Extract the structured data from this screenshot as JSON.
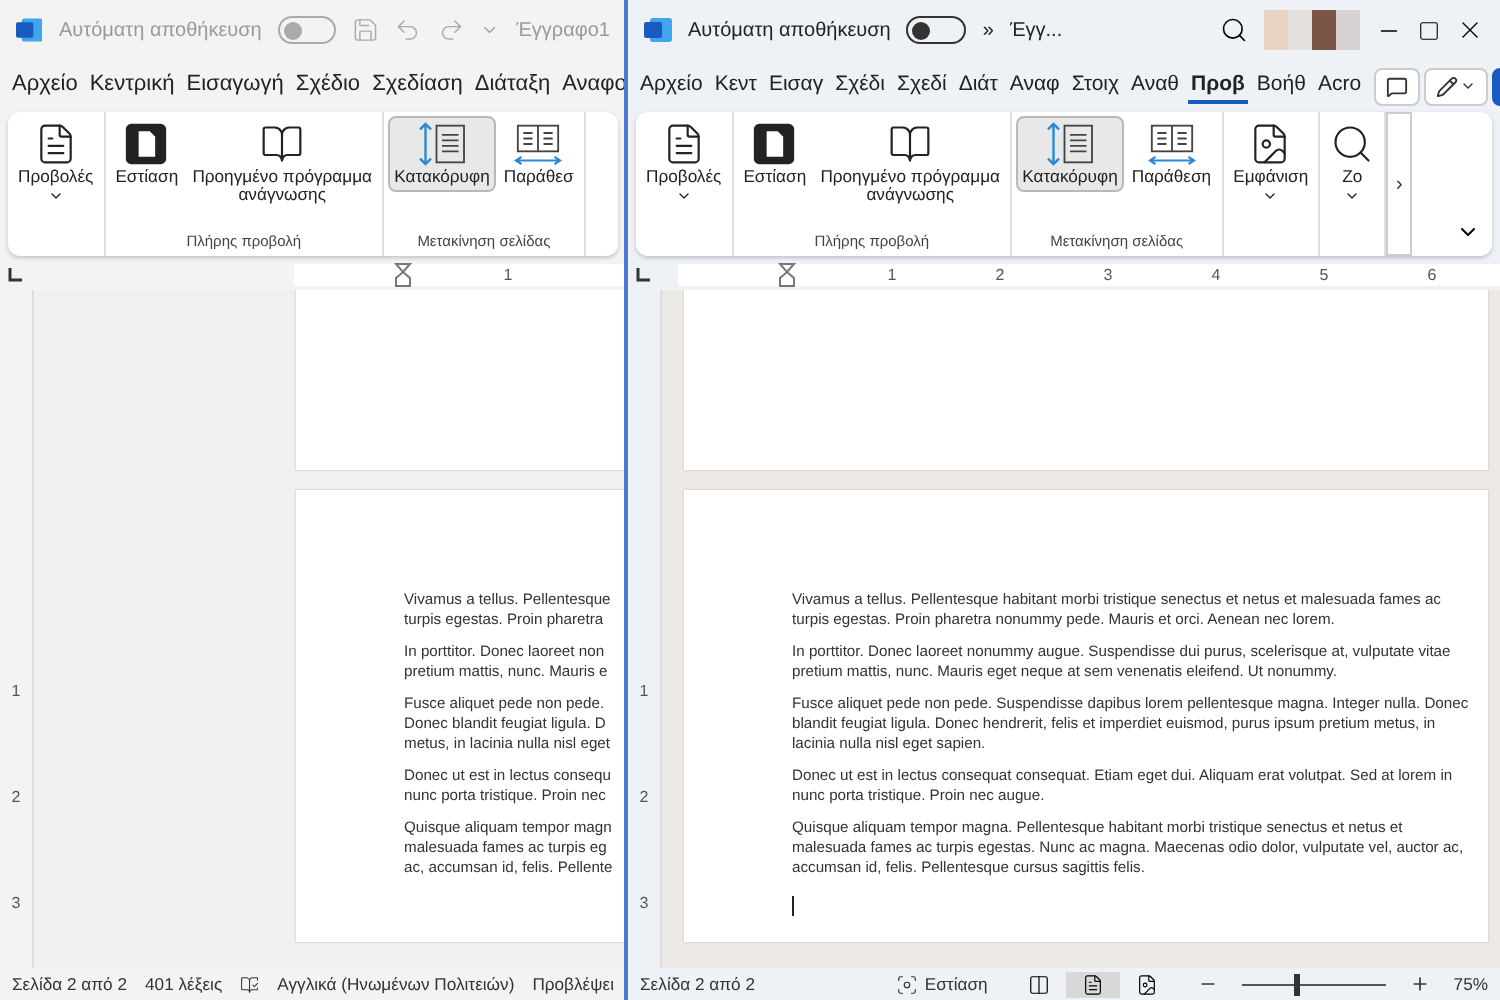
{
  "back_window": {
    "active": false,
    "title_bar": {
      "autosave_label": "Αυτόματη αποθήκευση",
      "autosave_on": false,
      "doc_title": "Έγγραφο1"
    },
    "tabs": [
      {
        "label": "Αρχείο",
        "selected": false
      },
      {
        "label": "Κεντρική",
        "selected": false
      },
      {
        "label": "Εισαγωγή",
        "selected": false
      },
      {
        "label": "Σχέδιο",
        "selected": false
      },
      {
        "label": "Σχεδίαση",
        "selected": false
      },
      {
        "label": "Διάταξη",
        "selected": false
      },
      {
        "label": "Αναφο",
        "selected": false
      }
    ],
    "ribbon": {
      "groups": [
        {
          "items": [
            {
              "kind": "views",
              "label": "Προβολές",
              "dropdown": true,
              "selected": false
            }
          ]
        },
        {
          "label": "Πλήρης προβολή",
          "items": [
            {
              "kind": "focus",
              "label": "Εστίαση",
              "dropdown": false,
              "selected": false
            },
            {
              "kind": "reader",
              "label": "Προηγμένο πρόγραμμα ανάγνωσης",
              "dropdown": false,
              "selected": false
            }
          ]
        },
        {
          "label": "Μετακίνηση σελίδας",
          "items": [
            {
              "kind": "vertical",
              "label": "Κατακόρυφη",
              "dropdown": false,
              "selected": true
            },
            {
              "kind": "side",
              "label": "Παράθεσ",
              "dropdown": false,
              "selected": false
            }
          ]
        }
      ]
    },
    "ruler": {
      "numbers": [
        "1"
      ]
    },
    "vertical_ruler": {
      "numbers": [
        "1",
        "2",
        "3"
      ]
    },
    "document": {
      "paragraphs": [
        {
          "lines": [
            "Vivamus a tellus. Pellentesque",
            "turpis egestas. Proin pharetra"
          ]
        },
        {
          "lines": [
            "In porttitor. Donec laoreet non",
            "pretium mattis, nunc. Mauris e"
          ]
        },
        {
          "lines": [
            "Fusce aliquet pede non pede.",
            "Donec blandit feugiat ligula. D",
            "metus, in lacinia nulla nisl eget"
          ]
        },
        {
          "lines": [
            "Donec ut est in lectus consequ",
            "nunc porta tristique. Proin nec"
          ]
        },
        {
          "lines": [
            "Quisque aliquam tempor magn",
            "malesuada fames ac turpis eg",
            "ac, accumsan id, felis. Pellente"
          ]
        }
      ]
    },
    "status_bar": {
      "page": "Σελίδα 2 από 2",
      "words": "401 λέξεις",
      "language": "Αγγλικά (Ηνωμένων Πολιτειών)",
      "predictions": "Προβλέψει"
    }
  },
  "front_window": {
    "active": true,
    "title_bar": {
      "autosave_label": "Αυτόματη αποθήκευση",
      "autosave_on": false,
      "overflow": "»",
      "doc_title": "Έγγ..."
    },
    "tabs": [
      {
        "label": "Αρχείο",
        "selected": false
      },
      {
        "label": "Κεντ",
        "selected": false
      },
      {
        "label": "Εισαγ",
        "selected": false
      },
      {
        "label": "Σχέδι",
        "selected": false
      },
      {
        "label": "Σχεδί",
        "selected": false
      },
      {
        "label": "Διάτ",
        "selected": false
      },
      {
        "label": "Αναφ",
        "selected": false
      },
      {
        "label": "Στοιχ",
        "selected": false
      },
      {
        "label": "Αναθ",
        "selected": false
      },
      {
        "label": "Προβ",
        "selected": true
      },
      {
        "label": "Βοήθ",
        "selected": false
      },
      {
        "label": "Acro",
        "selected": false
      }
    ],
    "ribbon": {
      "groups": [
        {
          "items": [
            {
              "kind": "views",
              "label": "Προβολές",
              "dropdown": true,
              "selected": false
            }
          ]
        },
        {
          "label": "Πλήρης προβολή",
          "items": [
            {
              "kind": "focus",
              "label": "Εστίαση",
              "dropdown": false,
              "selected": false
            },
            {
              "kind": "reader",
              "label": "Προηγμένο πρόγραμμα ανάγνωσης",
              "dropdown": false,
              "selected": false
            }
          ]
        },
        {
          "label": "Μετακίνηση σελίδας",
          "items": [
            {
              "kind": "vertical",
              "label": "Κατακόρυφη",
              "dropdown": false,
              "selected": true
            },
            {
              "kind": "side",
              "label": "Παράθεση",
              "dropdown": false,
              "selected": false
            }
          ]
        },
        {
          "items": [
            {
              "kind": "appearance",
              "label": "Εμφάνιση",
              "dropdown": true,
              "selected": false
            }
          ]
        },
        {
          "items": [
            {
              "kind": "zoom",
              "label": "Ζο",
              "dropdown": true,
              "selected": false
            }
          ]
        }
      ],
      "scroll_button": "›"
    },
    "ruler": {
      "numbers": [
        "1",
        "2",
        "3",
        "4",
        "5",
        "6"
      ]
    },
    "vertical_ruler": {
      "numbers": [
        "1",
        "2",
        "3"
      ]
    },
    "document": {
      "paragraphs": [
        "Vivamus a tellus. Pellentesque habitant morbi tristique senectus et netus et malesuada fames ac turpis egestas. Proin pharetra nonummy pede. Mauris et orci. Aenean nec lorem.",
        "In porttitor. Donec laoreet nonummy augue. Suspendisse dui purus, scelerisque at, vulputate vitae pretium mattis, nunc. Mauris eget neque at sem venenatis eleifend. Ut nonummy.",
        "Fusce aliquet pede non pede. Suspendisse dapibus lorem pellentesque magna. Integer nulla. Donec blandit feugiat ligula. Donec hendrerit, felis et imperdiet euismod, purus ipsum pretium metus, in lacinia nulla nisl eget sapien.",
        "Donec ut est in lectus consequat consequat. Etiam eget dui. Aliquam erat volutpat. Sed at lorem in nunc porta tristique. Proin nec augue.",
        "Quisque aliquam tempor magna. Pellentesque habitant morbi tristique senectus et netus et malesuada fames ac turpis egestas. Nunc ac magna. Maecenas odio dolor, vulputate vel, auctor ac, accumsan id, felis. Pellentesque cursus sagittis felis."
      ]
    },
    "status_bar": {
      "page": "Σελίδα 2 από 2",
      "focus": "Εστίαση",
      "views": [
        {
          "kind": "read",
          "selected": false
        },
        {
          "kind": "print",
          "selected": true
        },
        {
          "kind": "web",
          "selected": false
        }
      ],
      "zoom": {
        "level": 0.38,
        "reading": "75%"
      }
    }
  }
}
